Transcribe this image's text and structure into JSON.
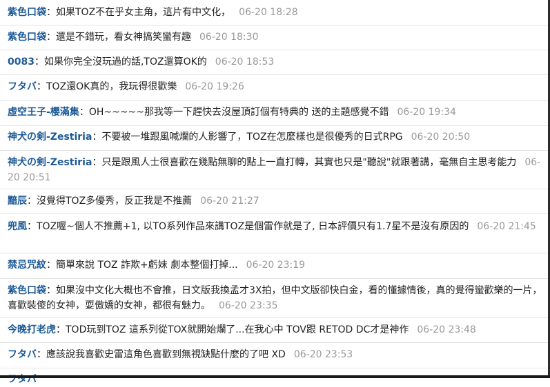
{
  "comments": [
    {
      "author": "紫色口袋",
      "text": "如果TOZ不在乎女主角，這片有中文化，",
      "time": "06-20 18:28"
    },
    {
      "author": "紫色口袋",
      "text": "還是不錯玩，看女神搞笑蠻有趣",
      "time": "06-20 18:30"
    },
    {
      "author": "0083",
      "text": "如果你完全沒玩過的話,TOZ還算OK的",
      "time": "06-20 18:53"
    },
    {
      "author": "フタバ",
      "text": "TOZ還OK真的，我玩得很歡樂",
      "time": "06-20 19:26"
    },
    {
      "author": "虛空王子-櫻滿集",
      "text": "OH~~~~~那我等一下趕快去沒屋頂訂個有特典的 送的主題感覺不錯",
      "time": "06-20 19:34"
    },
    {
      "author": "神犬の剣-Zestiria",
      "text": "不要被一堆跟風喊爛的人影響了，TOZ在怎麼樣也是很優秀的日式RPG",
      "time": "06-20 20:50"
    },
    {
      "author": "神犬の剣-Zestiria",
      "text": "只是跟風人士很喜歡在幾點無聊的點上一直打轉，其實也只是\"聽說\"就跟著講，毫無自主思考能力",
      "time": "06-20 20:51"
    },
    {
      "author": "黯辰",
      "text": "沒覺得TOZ多優秀，反正我是不推薦",
      "time": "06-20 21:27"
    },
    {
      "author": "兜風",
      "text": "TOZ喔~個人不推薦+1, 以TO系列作品來講TOZ是個雷作就是了, 日本評價只有1.7星不是沒有原因的",
      "time": "06-20 21:45"
    },
    {
      "author": "禁忌咒紋",
      "text": "簡單來說 TOZ 詐欺+虧妹 劇本整個打掉...",
      "time": "06-20 23:19"
    },
    {
      "author": "紫色口袋",
      "text": "如果沒中文化大概也不會推，日文版我換孟才3X拍，但中文版卻快白金，看的懂據情後，真的覺得蠻歡樂的一片，喜歡裝傻的女神，耍傲嬌的女神，都很有魅力。",
      "time": "06-20 23:35"
    },
    {
      "author": "今晚打老虎",
      "text": "TOD玩到TOZ 這系列從TOX就開始爛了...在我心中 TOV跟 RETOD DC才是神作",
      "time": "06-20 23:48"
    },
    {
      "author": "フタバ",
      "text": "應該說我喜歡史雷這角色喜歡到無視缺點什麼的了吧 XD",
      "time": "06-20 23:53"
    },
    {
      "author": "フタバ",
      "text": "",
      "time": ""
    }
  ],
  "colon": "："
}
